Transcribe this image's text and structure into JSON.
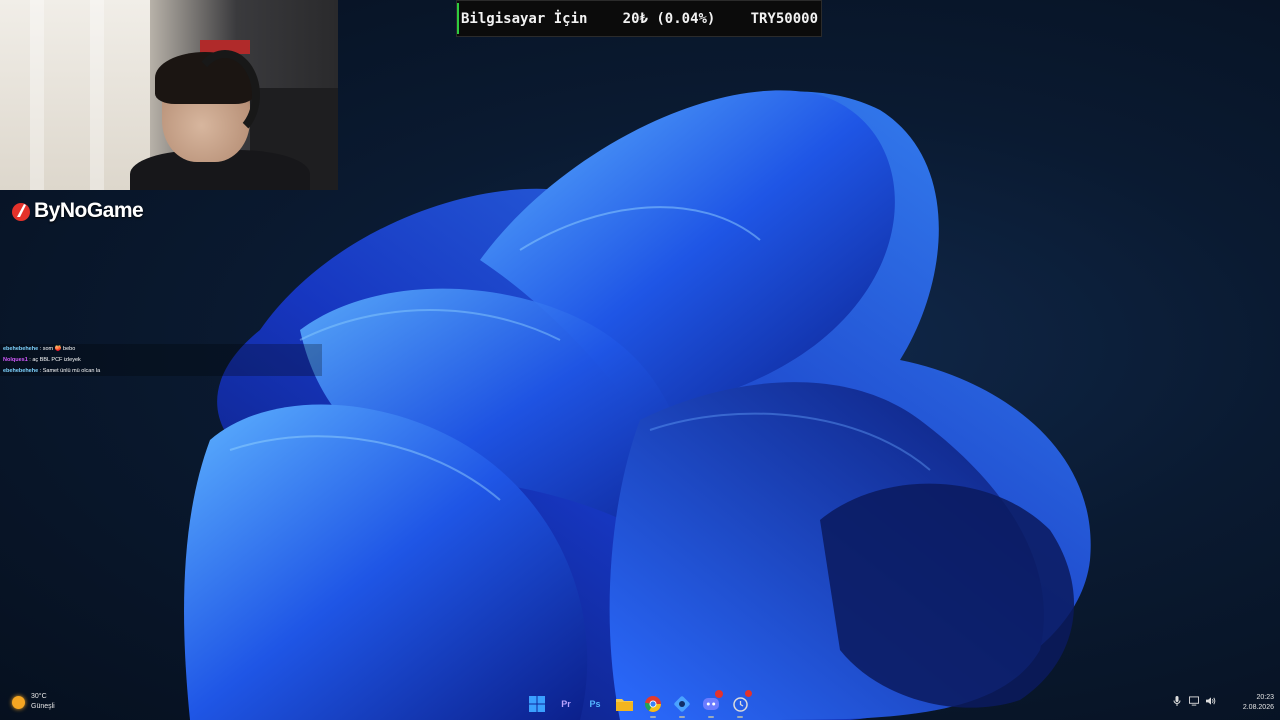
{
  "goal_banner": {
    "title": "Bilgisayar İçin",
    "amount": "20₺ (0.04%)",
    "target": "TRY50000"
  },
  "webcam": {
    "description_label": "Webcam feed"
  },
  "sponsor": {
    "name": "ByNoGame"
  },
  "chat": {
    "messages": [
      {
        "user": "ebehebehehe",
        "text": "som 🍑 bebo",
        "color": "#7fd4ff"
      },
      {
        "user": "Nolques1",
        "text": "aç BBL PCF izleyek",
        "color": "#d55bff"
      },
      {
        "user": "ebehebehehe",
        "text": "Samet ünlü mü olcan la",
        "color": "#7fd4ff"
      }
    ]
  },
  "taskbar": {
    "weather": {
      "temp": "30°C",
      "condition": "Güneşli"
    },
    "apps": [
      {
        "name": "start-button",
        "icon": "windows-logo-icon",
        "label": ""
      },
      {
        "name": "premiere-pro",
        "icon": "premiere-icon",
        "label": "Pr"
      },
      {
        "name": "photoshop",
        "icon": "photoshop-icon",
        "label": "Ps"
      },
      {
        "name": "file-explorer",
        "icon": "folder-icon",
        "label": ""
      },
      {
        "name": "chrome",
        "icon": "chrome-icon",
        "label": ""
      },
      {
        "name": "app-blue",
        "icon": "app-gear-icon",
        "label": ""
      },
      {
        "name": "discord",
        "icon": "discord-icon",
        "label": ""
      },
      {
        "name": "app-clock",
        "icon": "app-clock-icon",
        "label": ""
      }
    ],
    "clock": {
      "time": "20:23",
      "date": "2.08.2026"
    }
  },
  "colors": {
    "accent": "#1e6fff",
    "goal_progress": "#2ecc40"
  }
}
